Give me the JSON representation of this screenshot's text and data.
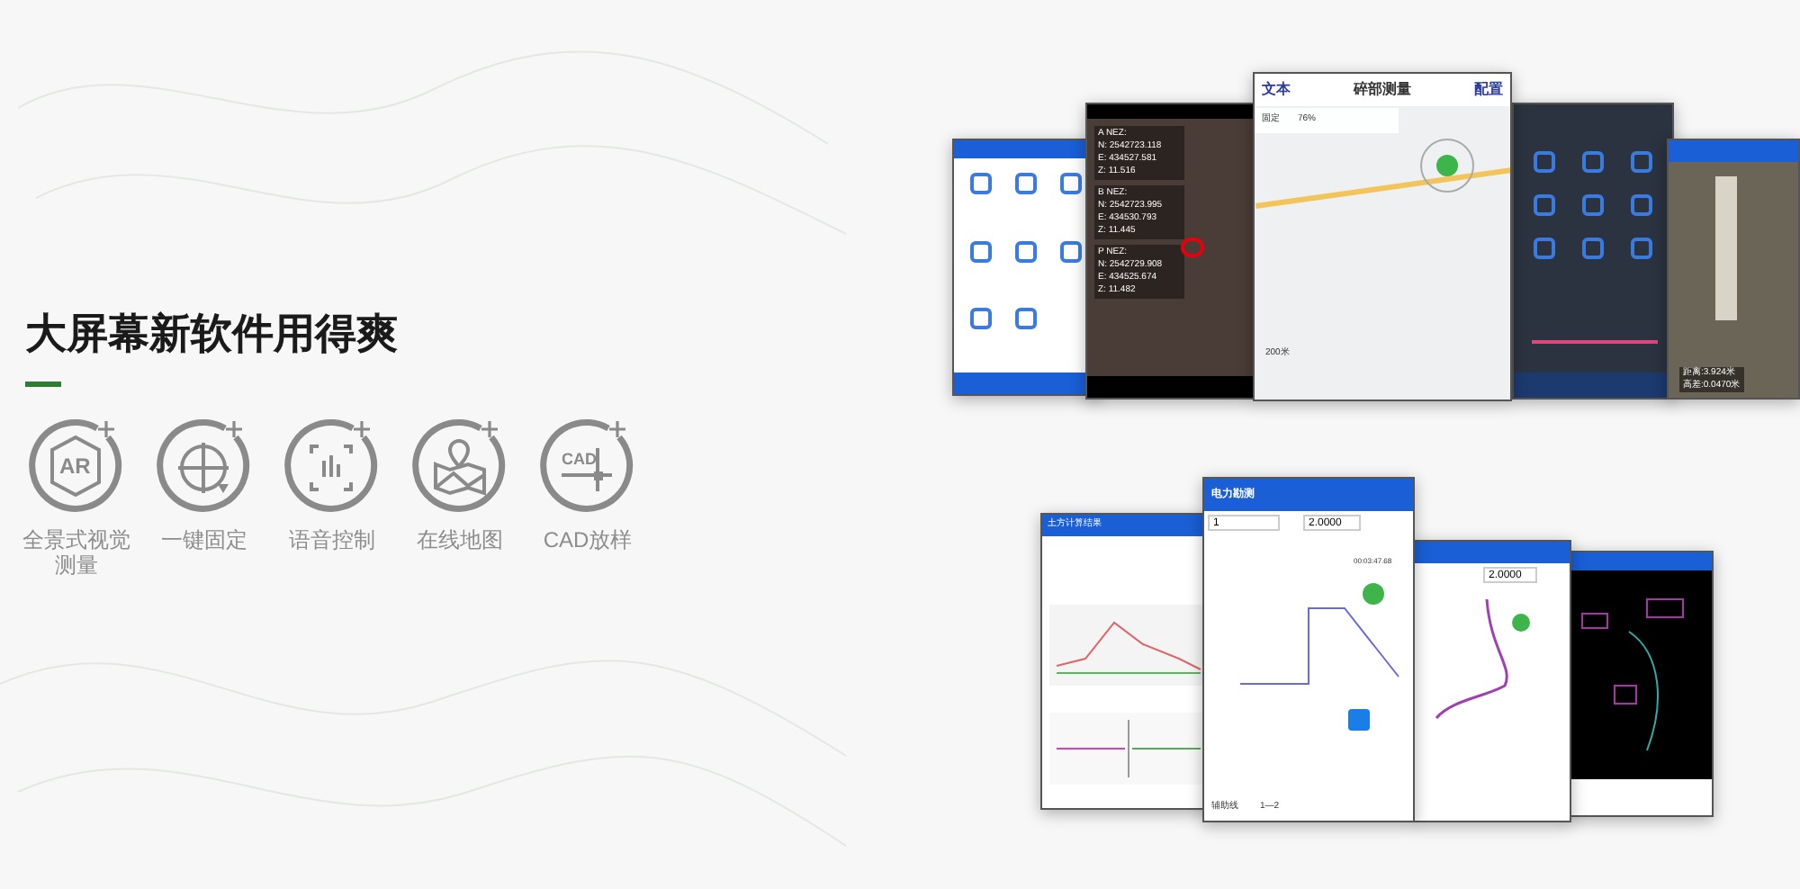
{
  "headline": "大屏幕新软件用得爽",
  "features": [
    {
      "kind": "ar",
      "label": "全景式视觉测量",
      "icon_text": "AR"
    },
    {
      "kind": "fix",
      "label": "一键固定"
    },
    {
      "kind": "voice",
      "label": "语音控制"
    },
    {
      "kind": "map",
      "label": "在线地图"
    },
    {
      "kind": "cad",
      "label": "CAD放样",
      "icon_text": "CAD"
    }
  ],
  "screens": [
    {
      "kind": "menu"
    },
    {
      "kind": "camera",
      "points": [
        {
          "title": "A NEZ:",
          "n": "N:  2542723.118",
          "e": "E:  434527.581",
          "z": "Z:  11.516"
        },
        {
          "title": "B NEZ:",
          "n": "N:  2542723.995",
          "e": "E:  434530.793",
          "z": "Z:  11.445"
        },
        {
          "title": "P NEZ:",
          "n": "N:  2542729.908",
          "e": "E:  434525.674",
          "z": "Z:  11.482"
        }
      ]
    },
    {
      "kind": "map",
      "left": "文本",
      "title": "碎部测量",
      "right": "配置",
      "status": "固定",
      "battery": "76%",
      "scale": "200米"
    },
    {
      "kind": "dark"
    },
    {
      "kind": "ar",
      "lines": [
        "距离:3.924米",
        "高差:0.0470米"
      ]
    },
    {
      "kind": "report",
      "title": "土方计算结果"
    },
    {
      "kind": "survey",
      "title": "电力勘测",
      "value1": "1",
      "value2": "2.0000",
      "time": "00:03:47.68",
      "footer": "辅助线",
      "footer_value": "1—2"
    },
    {
      "kind": "line",
      "value2": "2.0000"
    },
    {
      "kind": "cad"
    }
  ]
}
